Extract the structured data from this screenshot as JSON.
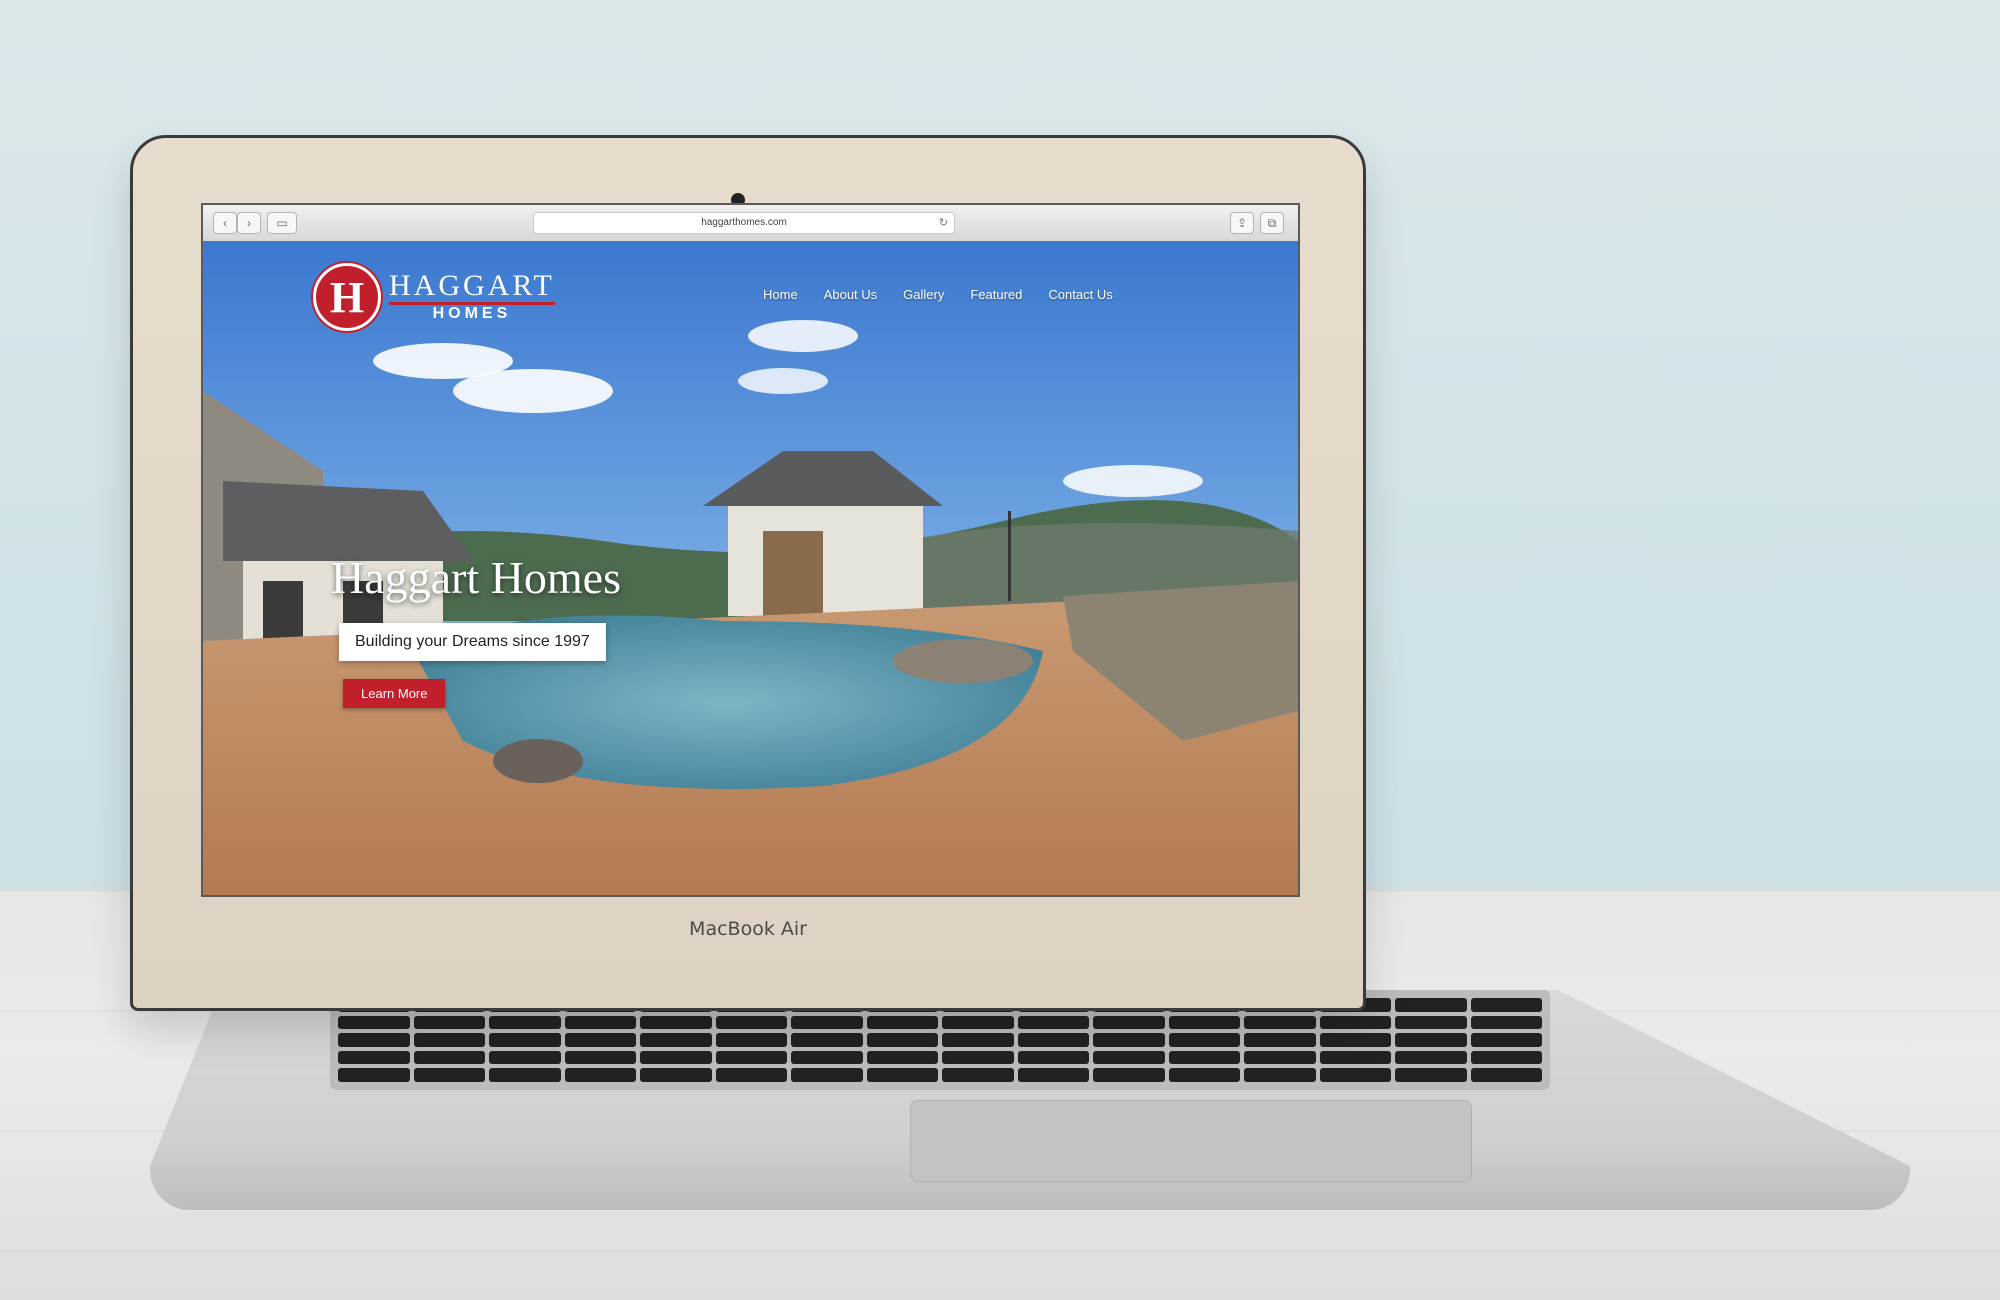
{
  "device": {
    "model_label": "MacBook Air"
  },
  "browser": {
    "url": "haggarthomes.com",
    "back_icon": "chevron-left-icon",
    "forward_icon": "chevron-right-icon",
    "sidebar_icon": "sidebar-icon",
    "reload_icon": "reload-icon",
    "share_icon": "share-icon",
    "tabs_icon": "tabs-icon"
  },
  "site": {
    "logo": {
      "monogram": "H",
      "line1": "HAGGART",
      "line2": "HOMES"
    },
    "nav": [
      "Home",
      "About Us",
      "Gallery",
      "Featured",
      "Contact Us"
    ],
    "hero": {
      "title": "Haggart Homes",
      "subtitle": "Building your Dreams since 1997",
      "cta": "Learn More"
    }
  },
  "colors": {
    "brand_red": "#c21f2c",
    "sky": "#3f7fd4"
  }
}
